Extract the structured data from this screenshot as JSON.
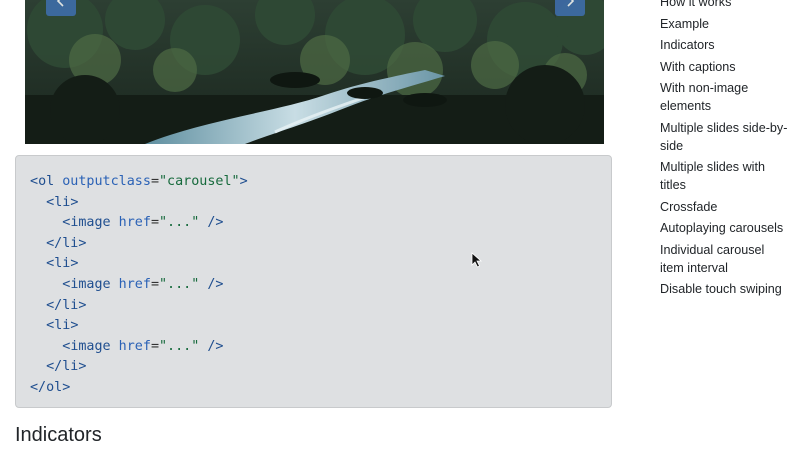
{
  "carousel": {
    "prev_icon": "chevron-left-icon",
    "next_icon": "chevron-right-icon",
    "control_color": "#3f6fb0"
  },
  "code": {
    "lines": [
      {
        "indent": "",
        "open": "<",
        "tag": "ol",
        "attr": " outputclass",
        "eq": "=",
        "val": "\"carousel\"",
        "close": ">"
      },
      {
        "indent": "  ",
        "open": "<",
        "tag": "li",
        "attr": "",
        "eq": "",
        "val": "",
        "close": ">"
      },
      {
        "indent": "    ",
        "open": "<",
        "tag": "image",
        "attr": " href",
        "eq": "=",
        "val": "\"...\"",
        "close": " />"
      },
      {
        "indent": "  ",
        "open": "</",
        "tag": "li",
        "attr": "",
        "eq": "",
        "val": "",
        "close": ">"
      },
      {
        "indent": "  ",
        "open": "<",
        "tag": "li",
        "attr": "",
        "eq": "",
        "val": "",
        "close": ">"
      },
      {
        "indent": "    ",
        "open": "<",
        "tag": "image",
        "attr": " href",
        "eq": "=",
        "val": "\"...\"",
        "close": " />"
      },
      {
        "indent": "  ",
        "open": "</",
        "tag": "li",
        "attr": "",
        "eq": "",
        "val": "",
        "close": ">"
      },
      {
        "indent": "  ",
        "open": "<",
        "tag": "li",
        "attr": "",
        "eq": "",
        "val": "",
        "close": ">"
      },
      {
        "indent": "    ",
        "open": "<",
        "tag": "image",
        "attr": " href",
        "eq": "=",
        "val": "\"...\"",
        "close": " />"
      },
      {
        "indent": "  ",
        "open": "</",
        "tag": "li",
        "attr": "",
        "eq": "",
        "val": "",
        "close": ">"
      },
      {
        "indent": "",
        "open": "</",
        "tag": "ol",
        "attr": "",
        "eq": "",
        "val": "",
        "close": ">"
      }
    ]
  },
  "heading": {
    "indicators": "Indicators"
  },
  "toc": {
    "items": [
      "How it works",
      "Example",
      "Indicators",
      "With captions",
      "With non-image elements",
      "Multiple slides side-by-side",
      "Multiple slides with titles",
      "Crossfade",
      "Autoplaying carousels",
      "Individual carousel item interval",
      "Disable touch swiping"
    ]
  }
}
